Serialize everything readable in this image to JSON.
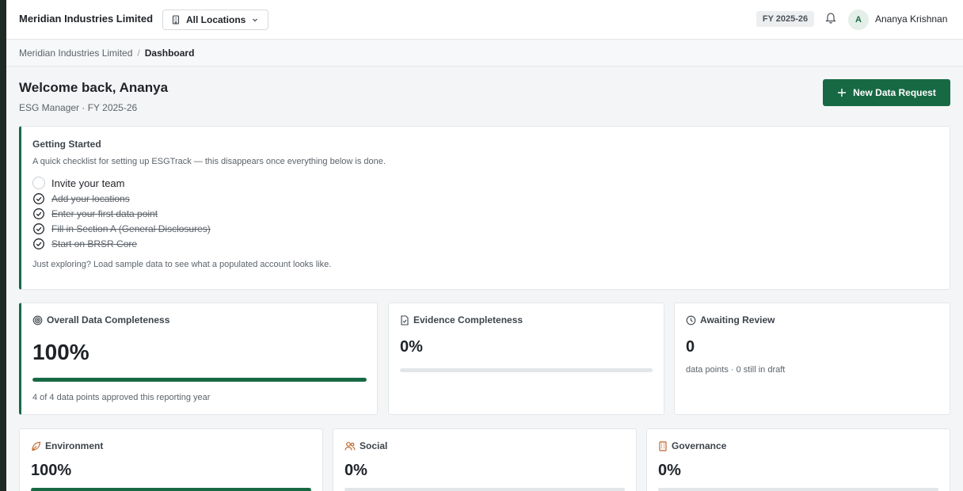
{
  "header": {
    "org_name": "Meridian Industries Limited",
    "location_selector": "All Locations",
    "fiscal_year": "FY 2025-26",
    "user_initial": "A",
    "user_name": "Ananya Krishnan"
  },
  "breadcrumb": {
    "items": [
      "Meridian Industries Limited",
      "Dashboard"
    ],
    "separator": "/"
  },
  "welcome": {
    "title": "Welcome back, Ananya",
    "subtitle": "ESG Manager · FY 2025-26"
  },
  "actions": {
    "new_request_label": "New Data Request"
  },
  "getting_started": {
    "title": "Getting Started",
    "description": "A quick checklist for setting up ESGTrack — this disappears once everything below is done.",
    "items": [
      {
        "label": "Invite your team",
        "done": false
      },
      {
        "label": "Add your locations",
        "done": true
      },
      {
        "label": "Enter your first data point",
        "done": true
      },
      {
        "label": "Fill in Section A (General Disclosures)",
        "done": true
      },
      {
        "label": "Start on BRSR Core",
        "done": true
      }
    ],
    "footer": "Just exploring? Load sample data to see what a populated account looks like."
  },
  "metrics": {
    "overall": {
      "title": "Overall Data Completeness",
      "value": "100%",
      "progress": 1.0,
      "caption": "4 of 4 data points approved this reporting year"
    },
    "evidence": {
      "title": "Evidence Completeness",
      "value": "0%",
      "progress": 0.0
    },
    "review": {
      "title": "Awaiting Review",
      "value": "0",
      "caption": "data points · 0 still in draft"
    }
  },
  "pillars": [
    {
      "title": "Environment",
      "value": "100%",
      "progress": 1.0,
      "icon": "leaf-icon"
    },
    {
      "title": "Social",
      "value": "0%",
      "progress": 0.0,
      "icon": "users-icon"
    },
    {
      "title": "Governance",
      "value": "0%",
      "progress": 0.0,
      "icon": "building-icon"
    }
  ],
  "colors": {
    "accent": "#176944",
    "pillar_icon": "#c0652b"
  }
}
